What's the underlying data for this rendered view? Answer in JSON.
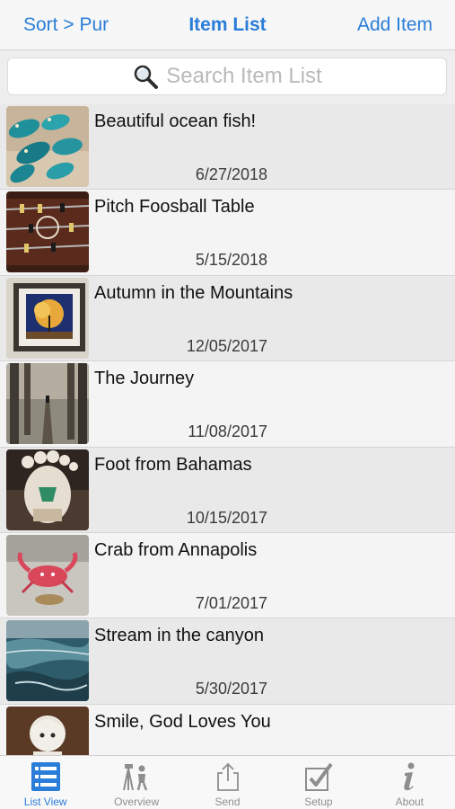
{
  "navbar": {
    "left_label": "Sort > Pur",
    "title": "Item List",
    "right_label": "Add Item",
    "accent_color": "#2a7dd8"
  },
  "search": {
    "placeholder": "Search Item List",
    "icon": "magnifying-glass-icon"
  },
  "items": [
    {
      "title": "Beautiful ocean fish!",
      "date": "6/27/2018",
      "thumbnail": "ocean-fish-photo"
    },
    {
      "title": "Pitch Foosball Table",
      "date": "5/15/2018",
      "thumbnail": "foosball-table-photo"
    },
    {
      "title": "Autumn in the Mountains",
      "date": "12/05/2017",
      "thumbnail": "framed-autumn-painting-photo"
    },
    {
      "title": "The Journey",
      "date": "11/08/2017",
      "thumbnail": "forest-path-photo"
    },
    {
      "title": "Foot from Bahamas",
      "date": "10/15/2017",
      "thumbnail": "foot-souvenir-photo"
    },
    {
      "title": "Crab from Annapolis",
      "date": "7/01/2017",
      "thumbnail": "red-crab-figurine-photo"
    },
    {
      "title": "Stream in the canyon",
      "date": "5/30/2017",
      "thumbnail": "canyon-stream-painting-photo"
    },
    {
      "title": "Smile, God Loves You",
      "date": "",
      "thumbnail": "porcelain-figurine-photo"
    }
  ],
  "tabbar": {
    "tabs": [
      {
        "label": "List View",
        "icon": "list-view-icon",
        "active": true
      },
      {
        "label": "Overview",
        "icon": "surveyor-icon",
        "active": false
      },
      {
        "label": "Send",
        "icon": "share-icon",
        "active": false
      },
      {
        "label": "Setup",
        "icon": "checkbox-icon",
        "active": false
      },
      {
        "label": "About",
        "icon": "info-icon",
        "active": false
      }
    ]
  }
}
